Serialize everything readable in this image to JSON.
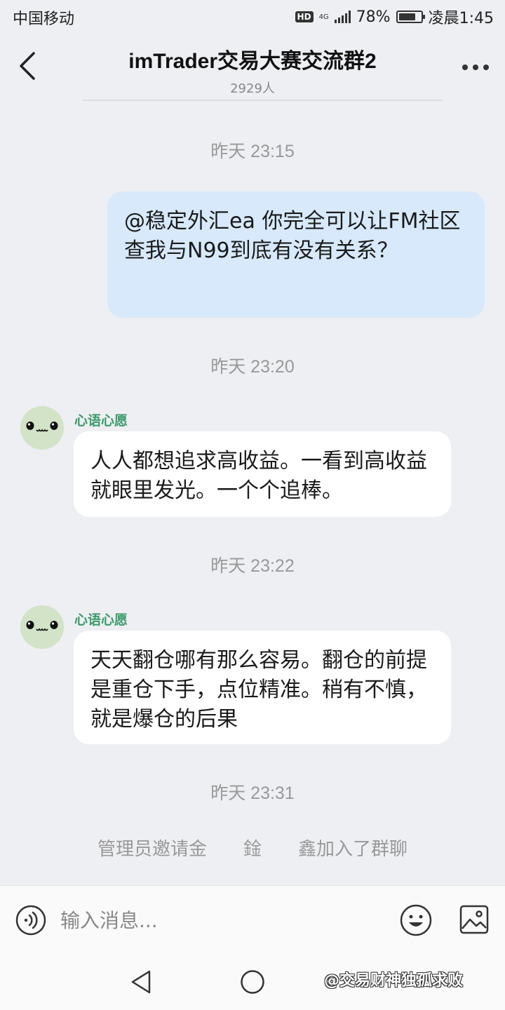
{
  "status_bar": {
    "carrier": "中国移动",
    "hd": "HD",
    "network": "4G",
    "battery": "78%",
    "battery_level": 0.78,
    "time": "凌晨1:45"
  },
  "header": {
    "title": "imTrader交易大赛交流群2",
    "member_count": "2929人"
  },
  "messages": [
    {
      "timestamp": "昨天 23:15",
      "from_self": true,
      "text": "@稳定外汇ea 你完全可以让FM社区查我与N99到底有没有关系？"
    },
    {
      "timestamp": "昨天 23:20",
      "from_self": false,
      "sender": "心语心愿",
      "text": "人人都想追求高收益。一看到高收益就眼里发光。一个个追棒。"
    },
    {
      "timestamp": "昨天 23:22",
      "from_self": false,
      "sender": "心语心愿",
      "text": "天天翻仓哪有那么容易。翻仓的前提是重仓下手，点位精准。稍有不慎，就是爆仓的后果"
    }
  ],
  "last_timestamp": "昨天 23:31",
  "system_message": "管理员邀请金　　鍂　　鑫加入了群聊",
  "input": {
    "placeholder": "输入消息..."
  },
  "watermark": "@交易财神独孤求败",
  "icons": {
    "back": "chevron-left-icon",
    "more": "more-dots-icon",
    "voice": "voice-icon",
    "emoji": "emoji-icon",
    "image": "image-icon",
    "nav_back": "nav-back-icon",
    "nav_home": "nav-home-icon"
  },
  "colors": {
    "background": "#eeeff3",
    "self_bubble": "#d7e9fb",
    "other_bubble": "#ffffff",
    "sender_name": "#3d9a6b",
    "avatar": "#d2e3c7"
  }
}
